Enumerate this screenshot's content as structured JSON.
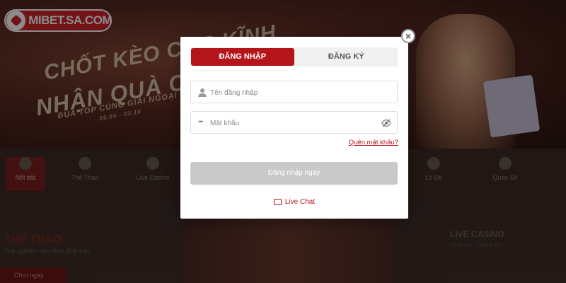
{
  "brand": {
    "logo_text": "MIBET.SA.COM",
    "accent": "#b4151b"
  },
  "banner": {
    "line1": "CHỐT KÈO CỰC KĨNH",
    "line2": "NHẬN QUÀ CỰC KHỦNG",
    "line3": "ĐUA TOP CÙNG GIẢI NGOẠI HẠNG",
    "line4": "26.04 - 03.10"
  },
  "nav": {
    "items": [
      {
        "label": "Nổi bật",
        "active": true
      },
      {
        "label": "Thể Thao"
      },
      {
        "label": "Live Casino"
      },
      {
        "label": "Lô Đề"
      },
      {
        "label": "Quay Số"
      }
    ]
  },
  "sections": {
    "sports_title": "THỂ THAO",
    "sports_sub": "Trải nghiệm sân chơi đỉnh cao",
    "sports_button": "Chơi ngay",
    "casino_title": "LIVE CASINO",
    "casino_sub": "Chơi vui - Thắng lớn"
  },
  "modal": {
    "close_icon": "close-icon",
    "tabs": [
      {
        "label": "ĐĂNG NHẬP",
        "active": true
      },
      {
        "label": "ĐĂNG KÝ",
        "active": false
      }
    ],
    "username": {
      "value": "",
      "placeholder": "Tên đăng nhập",
      "icon": "user-icon"
    },
    "password": {
      "value": "",
      "placeholder": "Mật khẩu",
      "icon": "password-dots-icon",
      "toggle_icon": "eye-slash-icon"
    },
    "forgot_label": "Quên mật khẩu?",
    "submit_label": "Đăng nhập ngay",
    "live_chat_label": "Live Chat",
    "live_chat_icon": "chat-icon"
  }
}
